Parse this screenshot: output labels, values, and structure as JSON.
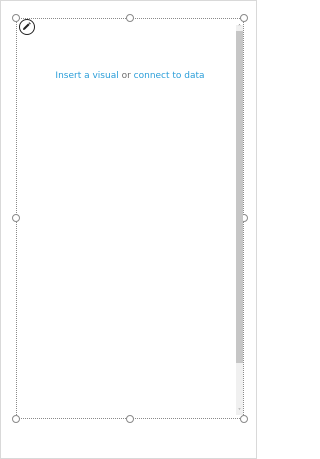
{
  "placeholder": {
    "prompt": {
      "insert_link": "Insert a visual",
      "connector": " or ",
      "connect_link": "connect to data"
    },
    "edit_icon": "pencil-icon"
  },
  "scrollbar": {
    "up_arrow": "˄",
    "down_arrow": "˅"
  },
  "colors": {
    "link": "#2b9ed9",
    "connector_text": "#6d6d6d",
    "selection_border": "#8a8a8a"
  }
}
